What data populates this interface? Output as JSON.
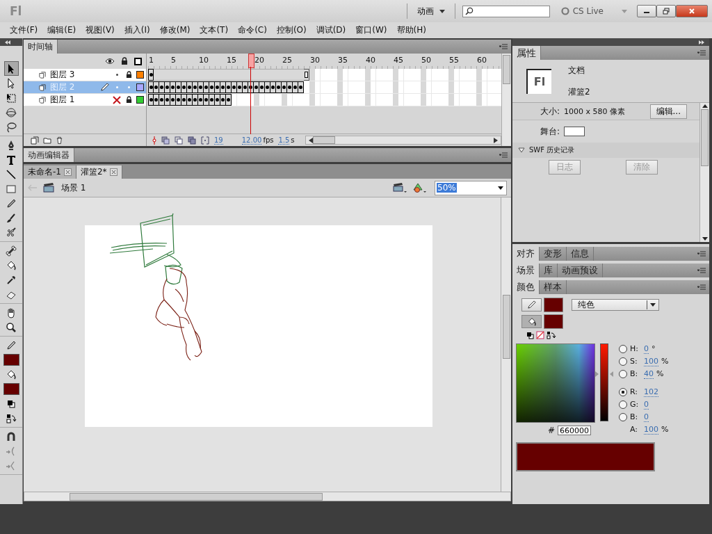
{
  "title_bar": {
    "logo": "Fl",
    "workspace": "动画",
    "cs_live": "CS Live"
  },
  "menu": [
    "文件(F)",
    "编辑(E)",
    "视图(V)",
    "插入(I)",
    "修改(M)",
    "文本(T)",
    "命令(C)",
    "控制(O)",
    "调试(D)",
    "窗口(W)",
    "帮助(H)"
  ],
  "tool_groups": [
    [
      {
        "kind": "selection",
        "selected": true
      },
      {
        "kind": "subselection",
        "selected": false
      },
      {
        "kind": "free-transform",
        "selected": false
      },
      {
        "kind": "rotation-3d",
        "selected": false
      },
      {
        "kind": "lasso",
        "selected": false
      }
    ],
    [
      {
        "kind": "pen",
        "selected": false
      },
      {
        "kind": "text",
        "selected": false
      },
      {
        "kind": "line",
        "selected": false
      },
      {
        "kind": "rectangle",
        "selected": false
      },
      {
        "kind": "pencil",
        "selected": false
      },
      {
        "kind": "brush",
        "selected": false
      },
      {
        "kind": "deco",
        "selected": false
      }
    ],
    [
      {
        "kind": "bone",
        "selected": false
      },
      {
        "kind": "bucket",
        "selected": false
      },
      {
        "kind": "eyedropper",
        "selected": false
      },
      {
        "kind": "eraser",
        "selected": false
      }
    ],
    [
      {
        "kind": "hand",
        "selected": false
      },
      {
        "kind": "zoom",
        "selected": false
      }
    ],
    [
      {
        "kind": "stroke-color",
        "selected": false
      },
      {
        "kind": "fill-color",
        "selected": false
      },
      {
        "kind": "default-colors",
        "selected": false
      },
      {
        "kind": "swap-colors",
        "selected": false
      }
    ],
    [
      {
        "kind": "snap",
        "selected": false
      },
      {
        "kind": "smooth",
        "selected": false
      },
      {
        "kind": "straighten",
        "selected": false
      }
    ]
  ],
  "timeline": {
    "tab": "时间轴",
    "ruler": [
      "1",
      "5",
      "10",
      "15",
      "20",
      "25",
      "30",
      "35",
      "40",
      "45",
      "50",
      "55",
      "60"
    ],
    "layers": [
      {
        "name": "图层 3",
        "selected": false,
        "editing": false,
        "hidden": false,
        "locked": true,
        "color": "#ff8000",
        "frames": [
          {
            "kind": "key"
          },
          {
            "kind": "span"
          },
          {
            "kind": "span"
          },
          {
            "kind": "span"
          },
          {
            "kind": "span"
          },
          {
            "kind": "span"
          },
          {
            "kind": "span"
          },
          {
            "kind": "span"
          },
          {
            "kind": "span"
          },
          {
            "kind": "span"
          },
          {
            "kind": "span"
          },
          {
            "kind": "span"
          },
          {
            "kind": "span"
          },
          {
            "kind": "span"
          },
          {
            "kind": "span"
          },
          {
            "kind": "span"
          },
          {
            "kind": "span"
          },
          {
            "kind": "span"
          },
          {
            "kind": "span"
          },
          {
            "kind": "span"
          },
          {
            "kind": "span"
          },
          {
            "kind": "span"
          },
          {
            "kind": "span"
          },
          {
            "kind": "span"
          },
          {
            "kind": "span"
          },
          {
            "kind": "span"
          },
          {
            "kind": "span"
          },
          {
            "kind": "span"
          },
          {
            "kind": "end"
          }
        ]
      },
      {
        "name": "图层 2",
        "selected": true,
        "editing": true,
        "hidden": false,
        "locked": false,
        "color": "#a8a8ff",
        "frames": [
          {
            "kind": "key"
          },
          {
            "kind": "key"
          },
          {
            "kind": "key"
          },
          {
            "kind": "key"
          },
          {
            "kind": "key"
          },
          {
            "kind": "key"
          },
          {
            "kind": "key"
          },
          {
            "kind": "key"
          },
          {
            "kind": "key"
          },
          {
            "kind": "key"
          },
          {
            "kind": "key"
          },
          {
            "kind": "key"
          },
          {
            "kind": "key"
          },
          {
            "kind": "key"
          },
          {
            "kind": "key"
          },
          {
            "kind": "key"
          },
          {
            "kind": "key"
          },
          {
            "kind": "key"
          },
          {
            "kind": "key"
          },
          {
            "kind": "key"
          },
          {
            "kind": "key"
          },
          {
            "kind": "key"
          },
          {
            "kind": "key"
          },
          {
            "kind": "key"
          },
          {
            "kind": "key"
          },
          {
            "kind": "key"
          },
          {
            "kind": "key"
          },
          {
            "kind": "key"
          }
        ]
      },
      {
        "name": "图层 1",
        "selected": false,
        "editing": false,
        "hidden": true,
        "locked": true,
        "color": "#33cc33",
        "frames": [
          {
            "kind": "key"
          },
          {
            "kind": "key"
          },
          {
            "kind": "key"
          },
          {
            "kind": "key"
          },
          {
            "kind": "key"
          },
          {
            "kind": "key"
          },
          {
            "kind": "key"
          },
          {
            "kind": "key"
          },
          {
            "kind": "key"
          },
          {
            "kind": "key"
          },
          {
            "kind": "key"
          },
          {
            "kind": "key"
          },
          {
            "kind": "key"
          },
          {
            "kind": "key"
          },
          {
            "kind": "key"
          }
        ]
      }
    ],
    "current_frame": "19",
    "frame_rate": "12.00",
    "fps_unit": "fps",
    "elapsed": "1.5",
    "time_unit": "s"
  },
  "motion_editor": {
    "tab": "动画编辑器"
  },
  "documents": [
    {
      "name": "未命名-1",
      "selected": false
    },
    {
      "name": "灌篮2*",
      "selected": true
    }
  ],
  "edit_bar": {
    "scene": "场景 1",
    "zoom": "50%"
  },
  "properties": {
    "tab": "属性",
    "doc_icon": "Fl",
    "doc_type": "文档",
    "doc_name": "灌篮2",
    "size_label": "大小:",
    "size_value": "1000 x 580 像素",
    "edit_button": "编辑...",
    "stage_label": "舞台:",
    "stage_swatch": {
      "color": "#ffffff"
    },
    "swf_history": {
      "title": "SWF 历史记录",
      "expanded": true,
      "buttons": [
        {
          "label": "日志",
          "disabled": true
        },
        {
          "label": "清除",
          "disabled": true
        }
      ]
    }
  },
  "panel_groups": [
    {
      "tabs": [
        {
          "label": "对齐",
          "selected": true
        },
        {
          "label": "变形",
          "selected": false
        },
        {
          "label": "信息",
          "selected": false
        }
      ]
    },
    {
      "tabs": [
        {
          "label": "场景",
          "selected": true
        },
        {
          "label": "库",
          "selected": false
        },
        {
          "label": "动画预设",
          "selected": false
        }
      ]
    },
    {
      "tabs": [
        {
          "label": "颜色",
          "selected": true
        },
        {
          "label": "样本",
          "selected": false
        }
      ]
    }
  ],
  "color_panel": {
    "stroke": {
      "color": "#660000"
    },
    "fill": {
      "color": "#660000"
    },
    "fill_type": "纯色",
    "brightness": {
      "level": 0.6
    },
    "channels": [
      {
        "kind": "radio",
        "label": "H:",
        "value": "0",
        "unit": "°",
        "selected": false
      },
      {
        "kind": "radio",
        "label": "S:",
        "value": "100",
        "unit": "%",
        "selected": false
      },
      {
        "kind": "radio",
        "label": "B:",
        "value": "40",
        "unit": "%",
        "selected": false
      },
      {
        "kind": "radio",
        "label": "R:",
        "value": "102",
        "selected": true
      },
      {
        "kind": "radio",
        "label": "G:",
        "value": "0",
        "selected": false
      },
      {
        "kind": "radio",
        "label": "B:",
        "value": "0",
        "selected": false
      },
      {
        "kind": "plain",
        "label": "A:",
        "value": "100",
        "unit": "%"
      }
    ],
    "hex_label": "#",
    "hex": "660000"
  }
}
